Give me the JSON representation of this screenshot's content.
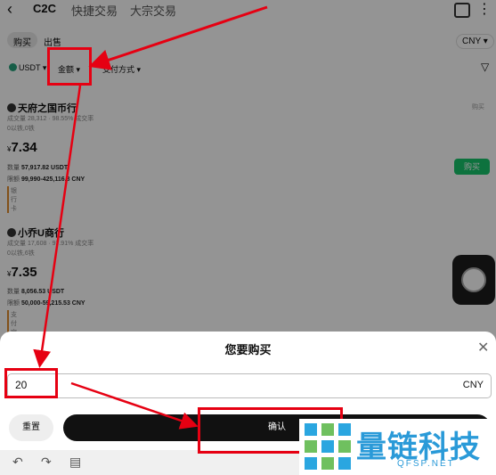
{
  "header": {
    "back_icon": "chevron-left-icon",
    "tabs": [
      "C2C",
      "快捷交易",
      "大宗交易"
    ]
  },
  "trade_side": {
    "buy": "购买",
    "sell": "出售"
  },
  "currency_select": "CNY ▾",
  "filters": {
    "coin": "USDT ▾",
    "amount": "金额 ▾",
    "payment": "支付方式 ▾"
  },
  "offers": [
    {
      "merchant": "天府之国币行",
      "stats": "成交量 28,312 · 98.55% 成交率",
      "badge": "0以铁,0铁",
      "price_prefix": "¥",
      "price": "7.34",
      "qty_label": "数量",
      "qty": "57,917.82 USDT",
      "limit_label": "限额",
      "limit": "99,990-425,116.8 CNY",
      "payment": "银行卡",
      "tag": "购买"
    },
    {
      "merchant": "小乔U商行",
      "stats": "成交量 17,608 · 97.91% 成交率",
      "badge": "0以铁,6铁",
      "price_prefix": "¥",
      "price": "7.35",
      "qty_label": "数量",
      "qty": "8,056.53 USDT",
      "limit_label": "限额",
      "limit": "50,000-59,215.53 CNY",
      "payment": "支付宝"
    }
  ],
  "buy_button": "购买",
  "sheet": {
    "title": "您要购买",
    "amount": "20",
    "currency": "CNY",
    "reset": "重置",
    "confirm": "确认"
  },
  "watermark": {
    "text": "量链科技",
    "sub": "QFSP.NET"
  },
  "colors": {
    "highlight": "#e60012",
    "accent_green": "#17c46b"
  }
}
